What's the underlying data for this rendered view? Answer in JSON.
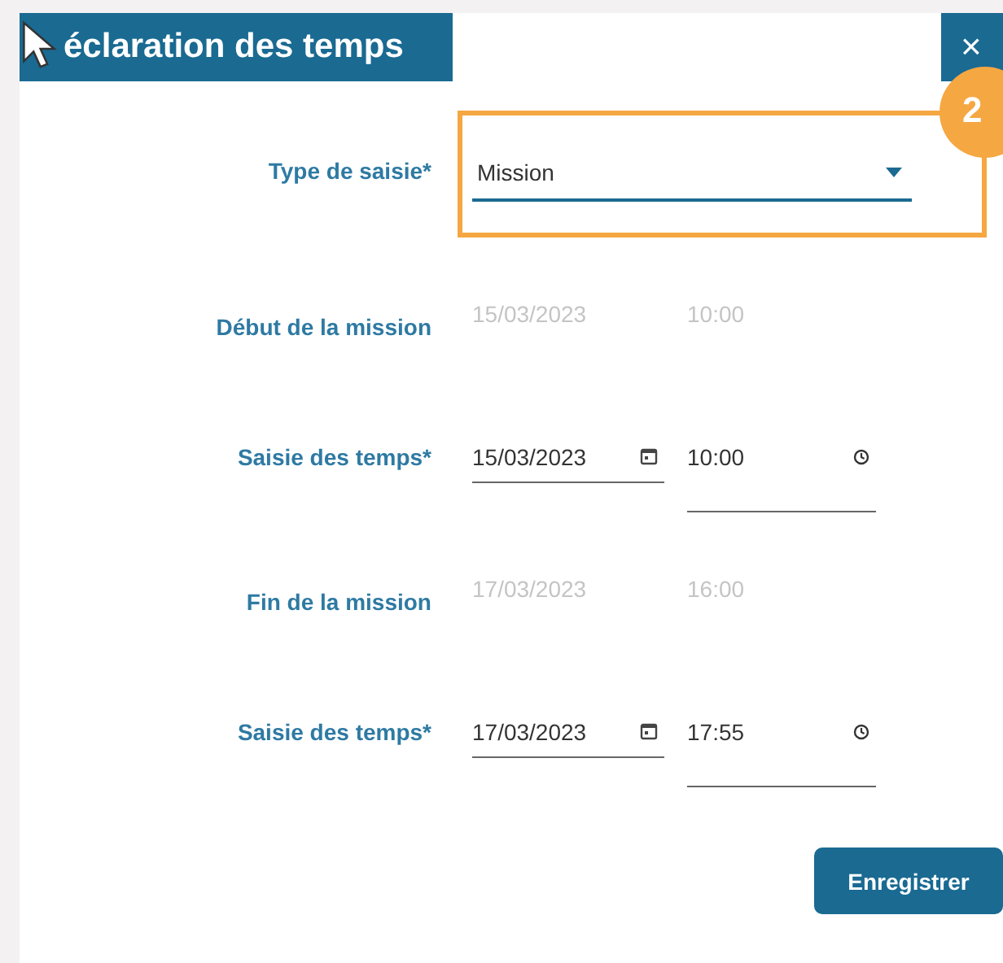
{
  "dialog": {
    "title": "éclaration des temps",
    "close": "×"
  },
  "type_field": {
    "label": "Type de saisie*",
    "value": "Mission"
  },
  "callout": {
    "badge": "2"
  },
  "sections": [
    {
      "kind": "readonly",
      "label": "Début de la mission",
      "date": "15/03/2023",
      "time": "10:00"
    },
    {
      "kind": "input",
      "label": "Saisie des temps*",
      "date": "15/03/2023",
      "time": "10:00"
    },
    {
      "kind": "readonly",
      "label": "Fin de la mission",
      "date": "17/03/2023",
      "time": "16:00"
    },
    {
      "kind": "input",
      "label": "Saisie des temps*",
      "date": "17/03/2023",
      "time": "17:55"
    }
  ],
  "save_button": "Enregistrer"
}
